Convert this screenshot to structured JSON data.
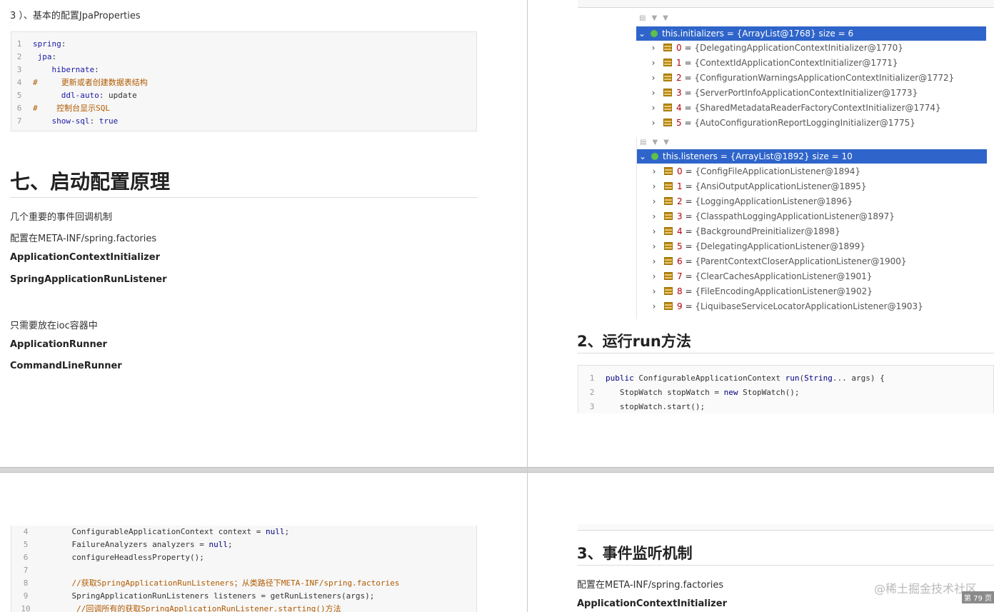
{
  "page1": {
    "intro": "3 ）、基本的配置JpaProperties",
    "code": [
      {
        "n": "1",
        "parts": [
          [
            "k",
            "spring"
          ],
          [
            "d",
            ":"
          ]
        ]
      },
      {
        "n": "2",
        "parts": [
          [
            "d",
            " "
          ],
          [
            "k",
            "jpa"
          ],
          [
            "d",
            ":"
          ]
        ]
      },
      {
        "n": "3",
        "parts": [
          [
            "d",
            "    "
          ],
          [
            "k",
            "hibernate"
          ],
          [
            "d",
            ":"
          ]
        ]
      },
      {
        "n": "4",
        "parts": [
          [
            "c",
            "#     更新或者创建数据表结构"
          ]
        ]
      },
      {
        "n": "5",
        "parts": [
          [
            "d",
            "      "
          ],
          [
            "k",
            "ddl-auto"
          ],
          [
            "d",
            ": update"
          ]
        ]
      },
      {
        "n": "6",
        "parts": [
          [
            "c",
            "#    控制台显示SQL"
          ]
        ]
      },
      {
        "n": "7",
        "parts": [
          [
            "d",
            "    "
          ],
          [
            "k",
            "show-sql"
          ],
          [
            "d",
            ": "
          ],
          [
            "k",
            "true"
          ]
        ]
      }
    ],
    "heading": "七、启动配置原理",
    "p1": "几个重要的事件回调机制",
    "p2": "配置在META-INF/spring.factories",
    "b1": "ApplicationContextInitializer",
    "b2": "SpringApplicationRunListener",
    "p3": "只需要放在ioc容器中",
    "b3": "ApplicationRunner",
    "b4": "CommandLineRunner"
  },
  "page2": {
    "initializers_header": "this.initializers = {ArrayList@1768}  size = 6",
    "initializers": [
      {
        "i": "0",
        "v": "{DelegatingApplicationContextInitializer@1770}"
      },
      {
        "i": "1",
        "v": "{ContextIdApplicationContextInitializer@1771}"
      },
      {
        "i": "2",
        "v": "{ConfigurationWarningsApplicationContextInitializer@1772}"
      },
      {
        "i": "3",
        "v": "{ServerPortInfoApplicationContextInitializer@1773}"
      },
      {
        "i": "4",
        "v": "{SharedMetadataReaderFactoryContextInitializer@1774}"
      },
      {
        "i": "5",
        "v": "{AutoConfigurationReportLoggingInitializer@1775}"
      }
    ],
    "listeners_header": "this.listeners = {ArrayList@1892}  size = 10",
    "listeners": [
      {
        "i": "0",
        "v": "{ConfigFileApplicationListener@1894}"
      },
      {
        "i": "1",
        "v": "{AnsiOutputApplicationListener@1895}"
      },
      {
        "i": "2",
        "v": "{LoggingApplicationListener@1896}"
      },
      {
        "i": "3",
        "v": "{ClasspathLoggingApplicationListener@1897}"
      },
      {
        "i": "4",
        "v": "{BackgroundPreinitializer@1898}"
      },
      {
        "i": "5",
        "v": "{DelegatingApplicationListener@1899}"
      },
      {
        "i": "6",
        "v": "{ParentContextCloserApplicationListener@1900}"
      },
      {
        "i": "7",
        "v": "{ClearCachesApplicationListener@1901}"
      },
      {
        "i": "8",
        "v": "{FileEncodingApplicationListener@1902}"
      },
      {
        "i": "9",
        "v": "{LiquibaseServiceLocatorApplicationListener@1903}"
      }
    ],
    "heading": "2、运行run方法",
    "code": [
      {
        "n": "1",
        "parts": [
          [
            "kw",
            "public"
          ],
          [
            "d",
            " ConfigurableApplicationContext "
          ],
          [
            "kw",
            "run"
          ],
          [
            "d",
            "("
          ],
          [
            "kw",
            "String"
          ],
          [
            "d",
            "... args) {"
          ]
        ]
      },
      {
        "n": "2",
        "parts": [
          [
            "d",
            "   StopWatch stopWatch = "
          ],
          [
            "kw",
            "new"
          ],
          [
            "d",
            " StopWatch();"
          ]
        ]
      },
      {
        "n": "3",
        "parts": [
          [
            "d",
            "   stopWatch.start();"
          ]
        ]
      }
    ]
  },
  "page3": {
    "code": [
      {
        "n": "4",
        "parts": [
          [
            "d",
            "    ConfigurableApplicationContext context = "
          ],
          [
            "kw",
            "null"
          ],
          [
            "d",
            ";"
          ]
        ]
      },
      {
        "n": "5",
        "parts": [
          [
            "d",
            "    FailureAnalyzers analyzers = "
          ],
          [
            "kw",
            "null"
          ],
          [
            "d",
            ";"
          ]
        ]
      },
      {
        "n": "6",
        "parts": [
          [
            "d",
            "    configureHeadlessProperty();"
          ]
        ]
      },
      {
        "n": "7",
        "parts": [
          [
            "d",
            ""
          ]
        ]
      },
      {
        "n": "8",
        "parts": [
          [
            "c",
            "    //获取SpringApplicationRunListeners；从类路径下META-INF/spring.factories"
          ]
        ]
      },
      {
        "n": "9",
        "parts": [
          [
            "d",
            "    SpringApplicationRunListeners listeners = getRunListeners(args);"
          ]
        ]
      },
      {
        "n": "10",
        "parts": [
          [
            "c",
            "     //回调所有的获取SpringApplicationRunListener.starting()方法"
          ]
        ]
      }
    ]
  },
  "page4": {
    "heading": "3、事件监听机制",
    "p1": "配置在META-INF/spring.factories",
    "b1": "ApplicationContextInitializer",
    "watermark": "@稀土掘金技术社区",
    "page_no": "第 79 页"
  }
}
